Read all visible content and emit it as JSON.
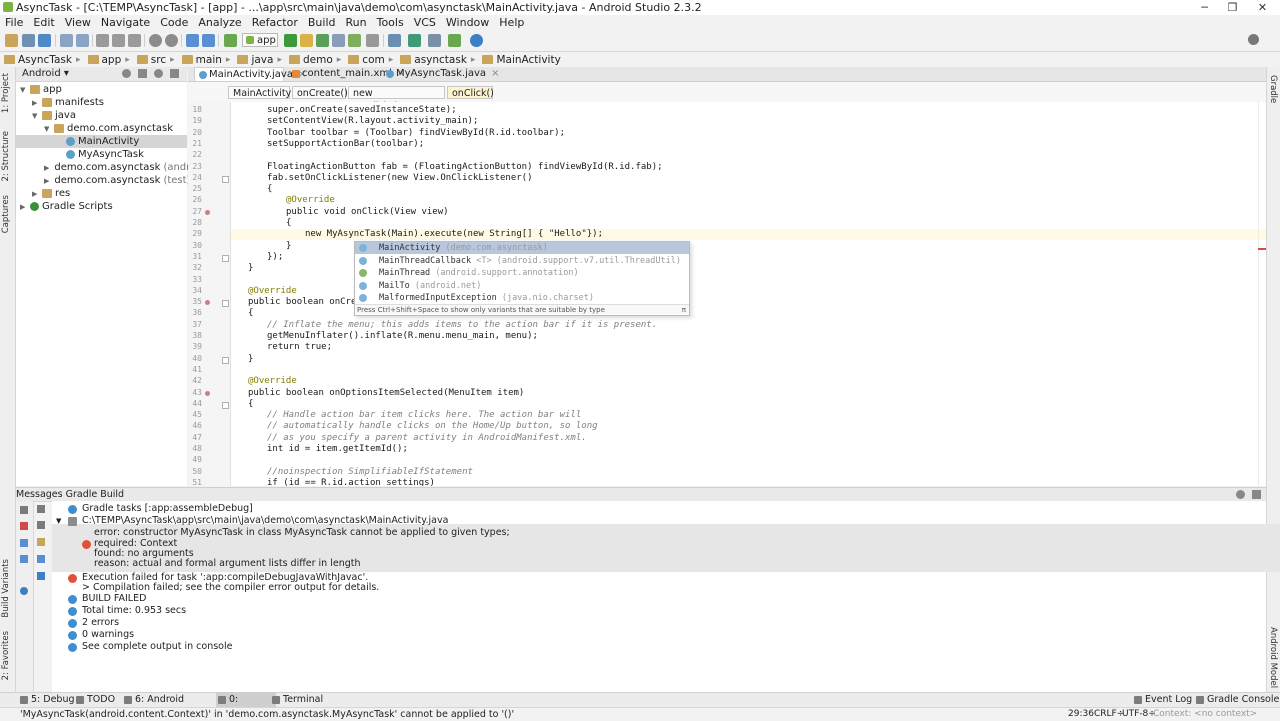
{
  "window": {
    "title": "AsyncTask - [C:\\TEMP\\AsyncTask] - [app] - ...\\app\\src\\main\\java\\demo\\com\\asynctask\\MainActivity.java - Android Studio 2.3.2",
    "minimize": "─",
    "maximize": "❐",
    "close": "✕"
  },
  "menu": [
    "File",
    "Edit",
    "View",
    "Navigate",
    "Code",
    "Analyze",
    "Refactor",
    "Build",
    "Run",
    "Tools",
    "VCS",
    "Window",
    "Help"
  ],
  "toolbar": {
    "run_config": "app"
  },
  "breadcrumb": [
    "AsyncTask",
    "app",
    "src",
    "main",
    "java",
    "demo",
    "com",
    "asynctask",
    "MainActivity"
  ],
  "left_tool_tabs": [
    "1: Project",
    "2: Structure",
    "Captures",
    "Build Variants",
    "2: Favorites"
  ],
  "right_tool_tabs": [
    "Gradle",
    "Android Model"
  ],
  "project": {
    "view_mode": "Android",
    "tree": [
      {
        "label": "app",
        "depth": 0,
        "type": "folder",
        "arrow": "▼"
      },
      {
        "label": "manifests",
        "depth": 1,
        "type": "folder",
        "arrow": "▶"
      },
      {
        "label": "java",
        "depth": 1,
        "type": "folder",
        "arrow": "▼"
      },
      {
        "label": "demo.com.asynctask",
        "depth": 2,
        "type": "folder",
        "arrow": "▼"
      },
      {
        "label": "MainActivity",
        "depth": 3,
        "type": "cls",
        "arrow": "",
        "selected": true
      },
      {
        "label": "MyAsyncTask",
        "depth": 3,
        "type": "cls",
        "arrow": ""
      },
      {
        "label": "demo.com.asynctask",
        "suffix": "(androidTest)",
        "depth": 2,
        "type": "folder",
        "arrow": "▶"
      },
      {
        "label": "demo.com.asynctask",
        "suffix": "(test)",
        "depth": 2,
        "type": "folder",
        "arrow": "▶"
      },
      {
        "label": "res",
        "depth": 1,
        "type": "folder",
        "arrow": "▶"
      },
      {
        "label": "Gradle Scripts",
        "depth": 0,
        "type": "gradle",
        "arrow": "▶"
      }
    ]
  },
  "editor_tabs": [
    {
      "label": "MainActivity.java",
      "kind": "java",
      "active": true
    },
    {
      "label": "content_main.xml",
      "kind": "xml",
      "active": false
    },
    {
      "label": "MyAsyncTask.java",
      "kind": "java",
      "active": false
    }
  ],
  "editor_crumbs": [
    "MainActivity",
    "onCreate()",
    "new OnClickListener",
    "onClick()"
  ],
  "code_lines": [
    {
      "n": "18",
      "text": "super.onCreate(savedInstanceState);",
      "indent": 2
    },
    {
      "n": "19",
      "text": "setContentView(R.layout.activity_main);",
      "indent": 2
    },
    {
      "n": "20",
      "text": "Toolbar toolbar = (Toolbar) findViewById(R.id.toolbar);",
      "indent": 2
    },
    {
      "n": "21",
      "text": "setSupportActionBar(toolbar);",
      "indent": 2
    },
    {
      "n": "22",
      "text": "",
      "indent": 2
    },
    {
      "n": "23",
      "text": "FloatingActionButton fab = (FloatingActionButton) findViewById(R.id.fab);",
      "indent": 2
    },
    {
      "n": "24",
      "text": "fab.setOnClickListener(new View.OnClickListener()",
      "indent": 2
    },
    {
      "n": "25",
      "text": "{",
      "indent": 2
    },
    {
      "n": "26",
      "text": "@Override",
      "indent": 3,
      "style": "ann"
    },
    {
      "n": "27",
      "text": "public void onClick(View view)",
      "indent": 3
    },
    {
      "n": "28",
      "text": "{",
      "indent": 3
    },
    {
      "n": "29",
      "text": "new MyAsyncTask(Main).execute(new String[] { \"Hello\"});",
      "indent": 4
    },
    {
      "n": "30",
      "text": "}",
      "indent": 3
    },
    {
      "n": "31",
      "text": "});",
      "indent": 2
    },
    {
      "n": "32",
      "text": "}",
      "indent": 1
    },
    {
      "n": "33",
      "text": "",
      "indent": 1
    },
    {
      "n": "34",
      "text": "@Override",
      "indent": 1,
      "style": "ann"
    },
    {
      "n": "35",
      "text": "public boolean onCreate",
      "indent": 1
    },
    {
      "n": "36",
      "text": "{",
      "indent": 1
    },
    {
      "n": "37",
      "text": "// Inflate the menu; this adds items to the action bar if it is present.",
      "indent": 2,
      "style": "cmt"
    },
    {
      "n": "38",
      "text": "getMenuInflater().inflate(R.menu.menu_main, menu);",
      "indent": 2
    },
    {
      "n": "39",
      "text": "return true;",
      "indent": 2
    },
    {
      "n": "40",
      "text": "}",
      "indent": 1
    },
    {
      "n": "41",
      "text": "",
      "indent": 1
    },
    {
      "n": "42",
      "text": "@Override",
      "indent": 1,
      "style": "ann"
    },
    {
      "n": "43",
      "text": "public boolean onOptionsItemSelected(MenuItem item)",
      "indent": 1
    },
    {
      "n": "44",
      "text": "{",
      "indent": 1
    },
    {
      "n": "45",
      "text": "// Handle action bar item clicks here. The action bar will",
      "indent": 2,
      "style": "cmt"
    },
    {
      "n": "46",
      "text": "// automatically handle clicks on the Home/Up button, so long",
      "indent": 2,
      "style": "cmt"
    },
    {
      "n": "47",
      "text": "// as you specify a parent activity in AndroidManifest.xml.",
      "indent": 2,
      "style": "cmt"
    },
    {
      "n": "48",
      "text": "int id = item.getItemId();",
      "indent": 2
    },
    {
      "n": "49",
      "text": "",
      "indent": 2
    },
    {
      "n": "50",
      "text": "//noinspection SimplifiableIfStatement",
      "indent": 2,
      "style": "cmt"
    },
    {
      "n": "51",
      "text": "if (id == R.id.action_settings)",
      "indent": 2
    }
  ],
  "completion": {
    "items": [
      {
        "name": "MainActivity",
        "pkg": "(demo.com.asynctask)",
        "kind": "cls",
        "selected": true
      },
      {
        "name": "MainThreadCallback",
        "pkg": "<T> (android.support.v7.util.ThreadUtil)",
        "kind": "cls"
      },
      {
        "name": "MainThread",
        "pkg": "(android.support.annotation)",
        "kind": "at"
      },
      {
        "name": "MailTo",
        "pkg": "(android.net)",
        "kind": "cls"
      },
      {
        "name": "MalformedInputException",
        "pkg": "(java.nio.charset)",
        "kind": "cls"
      }
    ],
    "hint": "Press Ctrl+Shift+Space to show only variants that are suitable by type",
    "pi": "π"
  },
  "messages": {
    "header": "Messages Gradle Build",
    "rows": [
      {
        "text": "Gradle tasks [:app:assembleDebug]",
        "icon": "info",
        "indent": 0
      },
      {
        "text": "C:\\TEMP\\AsyncTask\\app\\src\\main\\java\\demo\\com\\asynctask\\MainActivity.java",
        "icon": "file",
        "indent": 0
      },
      {
        "text": "error: constructor MyAsyncTask in class MyAsyncTask cannot be applied to given types;",
        "icon": "",
        "indent": 2
      },
      {
        "text": "required: Context",
        "icon": "err",
        "indent": 2
      },
      {
        "text": "found: no arguments",
        "icon": "",
        "indent": 2
      },
      {
        "text": "reason: actual and formal argument lists differ in length",
        "icon": "",
        "indent": 2
      },
      {
        "text": "Execution failed for task ':app:compileDebugJavaWithJavac'.",
        "icon": "err",
        "indent": 0
      },
      {
        "text": "> Compilation failed; see the compiler error output for details.",
        "icon": "",
        "indent": 0
      },
      {
        "text": "BUILD FAILED",
        "icon": "info",
        "indent": 0
      },
      {
        "text": "Total time: 0.953 secs",
        "icon": "info",
        "indent": 0
      },
      {
        "text": "2 errors",
        "icon": "info",
        "indent": 0
      },
      {
        "text": "0 warnings",
        "icon": "info",
        "indent": 0
      },
      {
        "text": "See complete output in console",
        "icon": "info",
        "indent": 0
      }
    ]
  },
  "bottom_tabs": [
    {
      "label": "5: Debug",
      "active": false
    },
    {
      "label": "TODO",
      "active": false
    },
    {
      "label": "6: Android Monitor",
      "active": false
    },
    {
      "label": "0: Messages",
      "active": true
    },
    {
      "label": "Terminal",
      "active": false
    }
  ],
  "bottom_right_tabs": [
    "Event Log",
    "Gradle Console"
  ],
  "status": {
    "message": "'MyAsyncTask(android.content.Context)' in 'demo.com.asynctask.MyAsyncTask' cannot be applied to '()'",
    "position": "29:36",
    "line_sep": "CRLF÷",
    "encoding": "UTF-8÷",
    "context": "Context: <no context>"
  }
}
